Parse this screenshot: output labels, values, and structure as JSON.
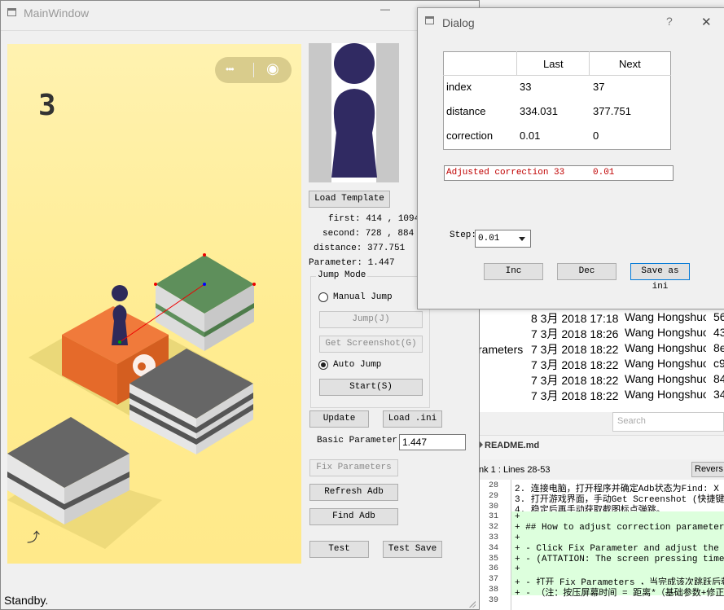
{
  "main_window": {
    "title": "MainWindow",
    "minimize": "—",
    "status": "Standby."
  },
  "game": {
    "score": "3",
    "menu_dots": "•••",
    "record": "◉",
    "share": "⤴"
  },
  "panel": {
    "load_template": "Load Template",
    "first": "first: 414 , 1094",
    "second": "second: 728 , 884",
    "distance": "distance: 377.751",
    "parameter": "Parameter: 1.447",
    "jump_mode": "Jump Mode",
    "manual_jump": "Manual Jump",
    "jump_btn": "Jump(J)",
    "get_screenshot": "Get Screenshot(G)",
    "auto_jump": "Auto Jump",
    "start_btn": "Start(S)",
    "update": "Update",
    "load_ini": "Load .ini",
    "basic_parameter_label": "Basic Parameter:",
    "basic_parameter_value": "1.447",
    "fix_parameters": "Fix Parameters",
    "refresh_adb": "Refresh Adb",
    "find_adb": "Find Adb",
    "test": "Test",
    "test_save": "Test Save"
  },
  "dialog": {
    "title": "Dialog",
    "help": "?",
    "close": "✕",
    "table": {
      "headers": [
        "",
        "Last",
        "Next"
      ],
      "rows": [
        [
          "index",
          "33",
          "37"
        ],
        [
          "distance",
          "334.031",
          "377.751"
        ],
        [
          "correction",
          "0.01",
          "0"
        ]
      ]
    },
    "adjusted_label": "Adjusted correction 33",
    "adjusted_value": "0.01",
    "step_label": "Step:",
    "step_value": "0.01",
    "inc": "Inc",
    "dec": "Dec",
    "save_ini": "Save as ini"
  },
  "background": {
    "commits": [
      {
        "date": "8 3月 2018 17:18",
        "author": "Wang Hongshuo",
        "hash": "56"
      },
      {
        "date": "7 3月 2018 18:26",
        "author": "Wang Hongshuo",
        "hash": "43"
      },
      {
        "date": "7 3月 2018 18:22",
        "author": "Wang Hongshuo",
        "hash": "8e"
      },
      {
        "date": "7 3月 2018 18:22",
        "author": "Wang Hongshuo",
        "hash": "c9"
      },
      {
        "date": "7 3月 2018 18:22",
        "author": "Wang Hongshuo",
        "hash": "84"
      },
      {
        "date": "7 3月 2018 18:22",
        "author": "Wang Hongshuo",
        "hash": "34"
      }
    ],
    "side_fragment": "rameters",
    "search_placeholder": "Search",
    "file_name": "README.md",
    "hunk": "nk 1 : Lines 28-53",
    "reverse": "Revers",
    "lines": [
      {
        "n": "28",
        "t": "  2. 连接电脑，打开程序并确定Adb状态为Find: X",
        "add": false
      },
      {
        "n": "29",
        "t": "  3. 打开游戏界面，手动Get Screenshot (快捷键",
        "add": false
      },
      {
        "n": "30",
        "t": "  4. 稳定后再手动获取截图标点弹跳。",
        "add": false
      },
      {
        "n": "31",
        "t": "+",
        "add": true
      },
      {
        "n": "32",
        "t": "+ ## How to adjust correction parameter: #",
        "add": true
      },
      {
        "n": "33",
        "t": "+",
        "add": true
      },
      {
        "n": "34",
        "t": "+ - Click Fix Parameter and adjust the cur",
        "add": true
      },
      {
        "n": "35",
        "t": "+ - (ATTATION: The screen pressing time = d",
        "add": true
      },
      {
        "n": "36",
        "t": "+",
        "add": true
      },
      {
        "n": "37",
        "t": "+ - 打开 Fix Parameters ，当完成该次跳跃后获取",
        "add": true
      },
      {
        "n": "38",
        "t": "+ - （注：按压屏幕时间 = 距离*（基础参数+修正参",
        "add": true
      },
      {
        "n": "39",
        "t": "",
        "add": false
      }
    ]
  }
}
